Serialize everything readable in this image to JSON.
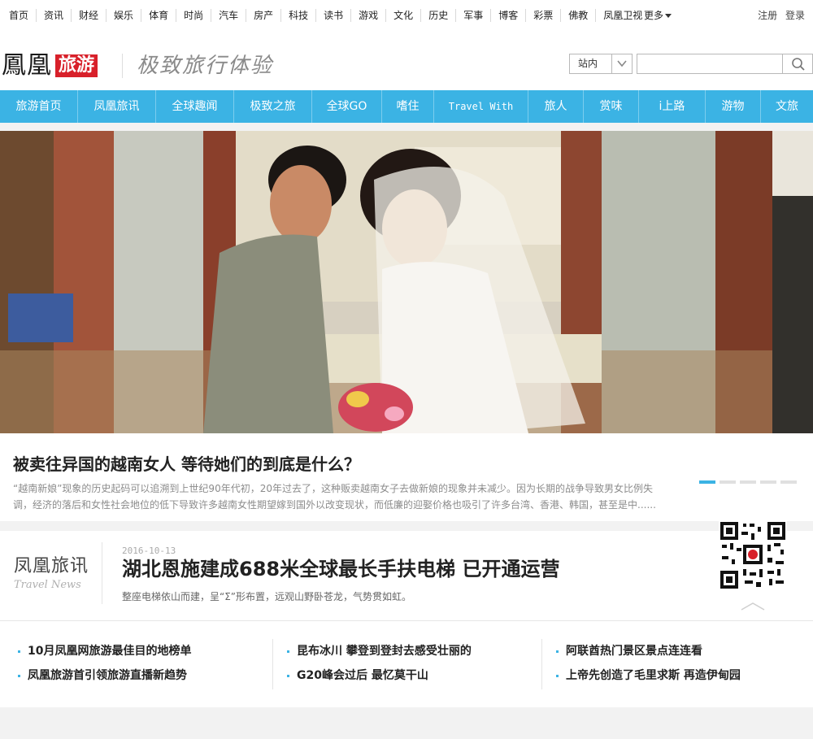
{
  "topnav": {
    "items": [
      "首页",
      "资讯",
      "财经",
      "娱乐",
      "体育",
      "时尚",
      "汽车",
      "房产",
      "科技",
      "读书",
      "游戏",
      "文化",
      "历史",
      "军事",
      "博客",
      "彩票",
      "佛教",
      "凤凰卫视"
    ],
    "more": "更多",
    "register": "注册",
    "login": "登录"
  },
  "header": {
    "brand": "鳳凰",
    "tag": "旅游",
    "slogan": "极致旅行体验",
    "search_scope": "站内",
    "search_placeholder": ""
  },
  "channels": [
    "旅游首页",
    "凤凰旅讯",
    "全球趣闻",
    "极致之旅",
    "全球GO",
    "嗜住",
    "Travel With",
    "旅人",
    "赏味",
    "i上路",
    "游物",
    "文旅"
  ],
  "hero": {
    "title": "被卖往异国的越南女人 等待她们的到底是什么？",
    "desc": "“越南新娘”现象的历史起码可以追溯到上世纪90年代初，20年过去了，这种贩卖越南女子去做新娘的现象并未减少。因为长期的战争导致男女比例失调，经济的落后和女性社会地位的低下导致许多越南女性期望嫁到国外以改变现状，而低廉的迎娶价格也吸引了许多台湾、香港、韩国，甚至是中......",
    "active_slide": 1,
    "slide_count": 5
  },
  "news": {
    "label_cn": "凤凰旅讯",
    "label_en": "Travel News",
    "date": "2016-10-13",
    "title": "湖北恩施建成688米全球最长手扶电梯 已开通运营",
    "sub": "整座电梯依山而建，呈“Σ”形布置，远观山野卧苍龙，气势贯如虹。"
  },
  "links": [
    [
      "10月凤凰网旅游最佳目的地榜单",
      "凤凰旅游首引领旅游直播新趋势"
    ],
    [
      "昆布冰川 攀登到登封去感受壮丽的",
      "G20峰会过后 最忆莫干山"
    ],
    [
      "阿联酋热门景区景点连连看",
      "上帝先创造了毛里求斯 再造伊甸园"
    ]
  ],
  "colors": {
    "accent": "#3bb3e4",
    "brand_red": "#d8202a"
  }
}
